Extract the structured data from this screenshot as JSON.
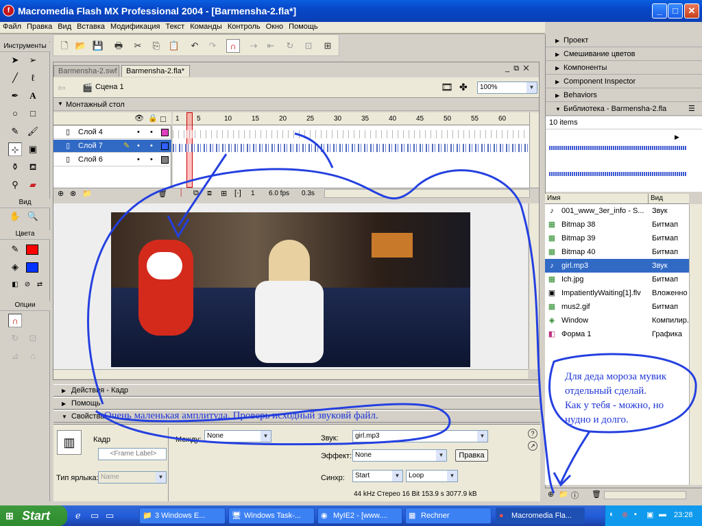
{
  "window": {
    "title": "Macromedia Flash MX Professional 2004 - [Barmensha-2.fla*]"
  },
  "menu": [
    "Файл",
    "Правка",
    "Вид",
    "Вставка",
    "Модификация",
    "Текст",
    "Команды",
    "Контроль",
    "Окно",
    "Помощь"
  ],
  "tools": {
    "title": "Инструменты",
    "view_label": "Вид",
    "colors_label": "Цвета",
    "options_label": "Опции",
    "stroke_color": "#ff0000",
    "fill_color": "#0033ff"
  },
  "document": {
    "tabs": [
      "Barmensha-2.swf",
      "Barmensha-2.fla*"
    ],
    "scene": "Сцена 1",
    "zoom": "100%"
  },
  "timeline": {
    "title": "Монтажный стол",
    "frame_numbers": [
      "1",
      "5",
      "10",
      "15",
      "20",
      "25",
      "30",
      "35",
      "40",
      "45",
      "50",
      "55",
      "60"
    ],
    "layers": [
      {
        "name": "Слой 4",
        "color": "#e040c0"
      },
      {
        "name": "Слой 7",
        "color": "#3060ff"
      },
      {
        "name": "Слой 6",
        "color": "#808080"
      }
    ],
    "current_frame": "1",
    "fps": "6.0 fps",
    "time": "0.3s"
  },
  "panels": {
    "actions": "Действия - Кадр",
    "help": "Помощь",
    "props": "Свойства"
  },
  "properties": {
    "frame_label": "Кадр",
    "frame_placeholder": "<Frame Label>",
    "tween_label": "Между:",
    "tween_value": "None",
    "label_type": "Тип ярлыка:",
    "label_type_value": "Name",
    "sound_label": "Звук:",
    "sound_value": "girl.mp3",
    "effect_label": "Эффект:",
    "effect_value": "None",
    "edit_btn": "Правка",
    "sync_label": "Синхр:",
    "sync_value": "Start",
    "loop_value": "Loop",
    "info": "44 kHz Стерео 16 Bit 153.9 s 3077.9 kB"
  },
  "right_panels": {
    "items": [
      "Проект",
      "Смешивание цветов",
      "Компоненты",
      "Component Inspector",
      "Behaviors"
    ],
    "library_title": "Библиотека - Barmensha-2.fla",
    "library_count": "10 items",
    "col_name": "Имя",
    "col_kind": "Вид",
    "library_items": [
      {
        "name": "001_www_3er_info - S...",
        "kind": "Звук",
        "icon": "♪"
      },
      {
        "name": "Bitmap 38",
        "kind": "Битмап",
        "icon": "▦"
      },
      {
        "name": "Bitmap 39",
        "kind": "Битмап",
        "icon": "▦"
      },
      {
        "name": "Bitmap 40",
        "kind": "Битмап",
        "icon": "▦"
      },
      {
        "name": "girl.mp3",
        "kind": "Звук",
        "icon": "♪"
      },
      {
        "name": "Ich.jpg",
        "kind": "Битмап",
        "icon": "▦"
      },
      {
        "name": "ImpatientlyWaiting[1].flv",
        "kind": "Вложенно",
        "icon": "▣"
      },
      {
        "name": "mus2.gif",
        "kind": "Битмап",
        "icon": "▦"
      },
      {
        "name": "Window",
        "kind": "Компилир.",
        "icon": "◈"
      },
      {
        "name": "Форма 1",
        "kind": "Графика",
        "icon": "◧"
      }
    ],
    "selected_index": 4
  },
  "annotations": {
    "amplitude": "Очень маленькая амплитуда. Проверь исходный звуковй файл.",
    "santa_lines": [
      "Для деда мороза мувик",
      "отдельный сделай.",
      "Как у тебя - можно, но",
      "нудно и долго."
    ]
  },
  "taskbar": {
    "start": "Start",
    "tasks": [
      "3 Windows E...",
      "Windows Task-...",
      "MyIE2 - [www....",
      "Rechner",
      "Macromedia Fla..."
    ],
    "clock": "23:28"
  }
}
